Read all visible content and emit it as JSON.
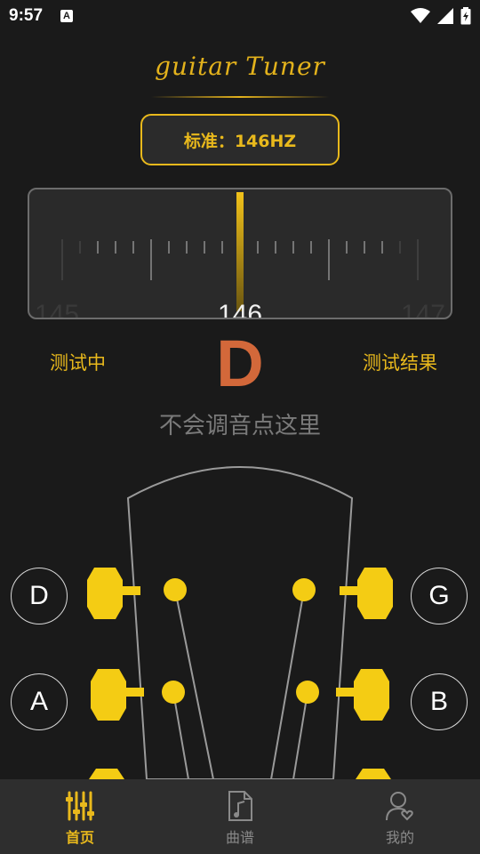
{
  "status": {
    "time": "9:57",
    "a_badge": "A"
  },
  "logo": {
    "text": "guitar Tuner"
  },
  "standard": {
    "label": "标准：146HZ"
  },
  "meter": {
    "left_value": "145",
    "center_value": "146",
    "right_value": "147",
    "needle_position": 0.5
  },
  "labels": {
    "testing": "测试中",
    "result": "测试结果",
    "note": "D",
    "hint": "不会调音点这里"
  },
  "strings": {
    "left": [
      "D",
      "A"
    ],
    "right": [
      "G",
      "B"
    ]
  },
  "tabs": [
    {
      "label": "首页",
      "icon": "tuner-sliders-icon",
      "active": true
    },
    {
      "label": "曲谱",
      "icon": "music-sheet-icon",
      "active": false
    },
    {
      "label": "我的",
      "icon": "profile-heart-icon",
      "active": false
    }
  ],
  "colors": {
    "accent": "#e9b91c",
    "note": "#d3683a",
    "background": "#1a1a1a",
    "tabbar": "#2e2e2e"
  }
}
